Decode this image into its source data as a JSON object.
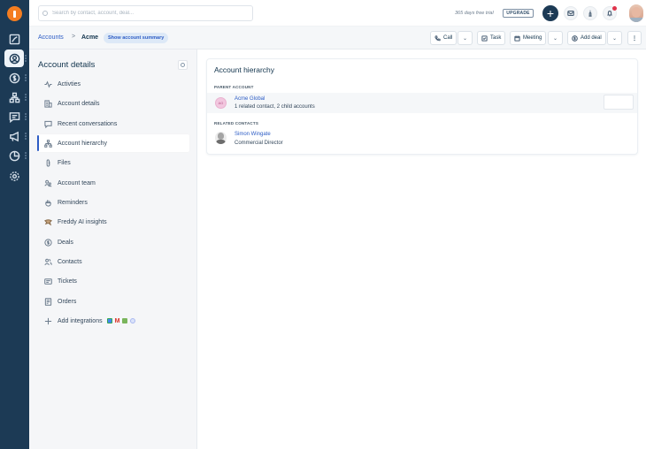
{
  "app": {
    "logo": "freshworks-logo"
  },
  "rail": {
    "items": [
      {
        "name": "dashboard",
        "icon": "chart-icon"
      },
      {
        "name": "contacts",
        "icon": "user-circle-icon",
        "active": true
      },
      {
        "name": "deals",
        "icon": "dollar-circle-icon"
      },
      {
        "name": "org-chart",
        "icon": "org-chart-icon"
      },
      {
        "name": "conversations",
        "icon": "chat-icon"
      },
      {
        "name": "campaigns",
        "icon": "megaphone-icon"
      },
      {
        "name": "reports",
        "icon": "pie-chart-icon"
      },
      {
        "name": "settings",
        "icon": "gear-icon"
      }
    ]
  },
  "topbar": {
    "search_placeholder": "Search by contact, account, deal...",
    "trial_text": "365 days free trial",
    "upgrade_label": "UPGRADE",
    "plus_label": "+",
    "icons": [
      "mail-icon",
      "phone-icon",
      "bell-icon"
    ],
    "notification_color": "#e0344b"
  },
  "subbar": {
    "breadcrumb_root": "Accounts",
    "breadcrumb_sep": ">",
    "breadcrumb_current": "Acme",
    "summary_pill": "Show account summary",
    "actions": {
      "call": "Call",
      "task": "Task",
      "meeting": "Meeting",
      "add_deal": "Add deal",
      "more": "⋮",
      "chevron": "⌄"
    }
  },
  "leftpanel": {
    "title": "Account details",
    "items": [
      {
        "label": "Activties",
        "icon": "activity-icon"
      },
      {
        "label": "Account details",
        "icon": "building-icon"
      },
      {
        "label": "Recent conversations",
        "icon": "chat-icon"
      },
      {
        "label": "Account hierarchy",
        "icon": "hierarchy-icon",
        "active": true
      },
      {
        "label": "Files",
        "icon": "paperclip-icon"
      },
      {
        "label": "Account team",
        "icon": "team-icon"
      },
      {
        "label": "Reminders",
        "icon": "hand-icon"
      },
      {
        "label": "Freddy AI insights",
        "icon": "freddy-icon"
      },
      {
        "label": "Deals",
        "icon": "dollar-circle-icon"
      },
      {
        "label": "Contacts",
        "icon": "users-icon"
      },
      {
        "label": "Tickets",
        "icon": "ticket-icon"
      },
      {
        "label": "Orders",
        "icon": "order-icon"
      },
      {
        "label": "Add integrations",
        "icon": "plus-icon"
      }
    ],
    "integration_icons": [
      {
        "name": "google-workspace-icon",
        "color": "#4285f4"
      },
      {
        "name": "gmail-icon",
        "color": "#d93025"
      },
      {
        "name": "shopify-icon",
        "color": "#7ab55c"
      },
      {
        "name": "other-integration-icon",
        "color": "#a9b8f0"
      }
    ]
  },
  "hierarchy": {
    "title": "Account hierarchy",
    "parent_label": "PARENT ACCOUNT",
    "parent": {
      "initials": "AG",
      "name": "Acme Global",
      "summary": "1 related contact, 2 child accounts"
    },
    "contacts_label": "RELATED CONTACTS",
    "contacts": [
      {
        "name": "Simon Wingate",
        "title": "Commercial Director"
      }
    ]
  },
  "colors": {
    "rail_bg": "#1c3a55",
    "accent": "#2c5cc5",
    "logo": "#f47d20"
  }
}
